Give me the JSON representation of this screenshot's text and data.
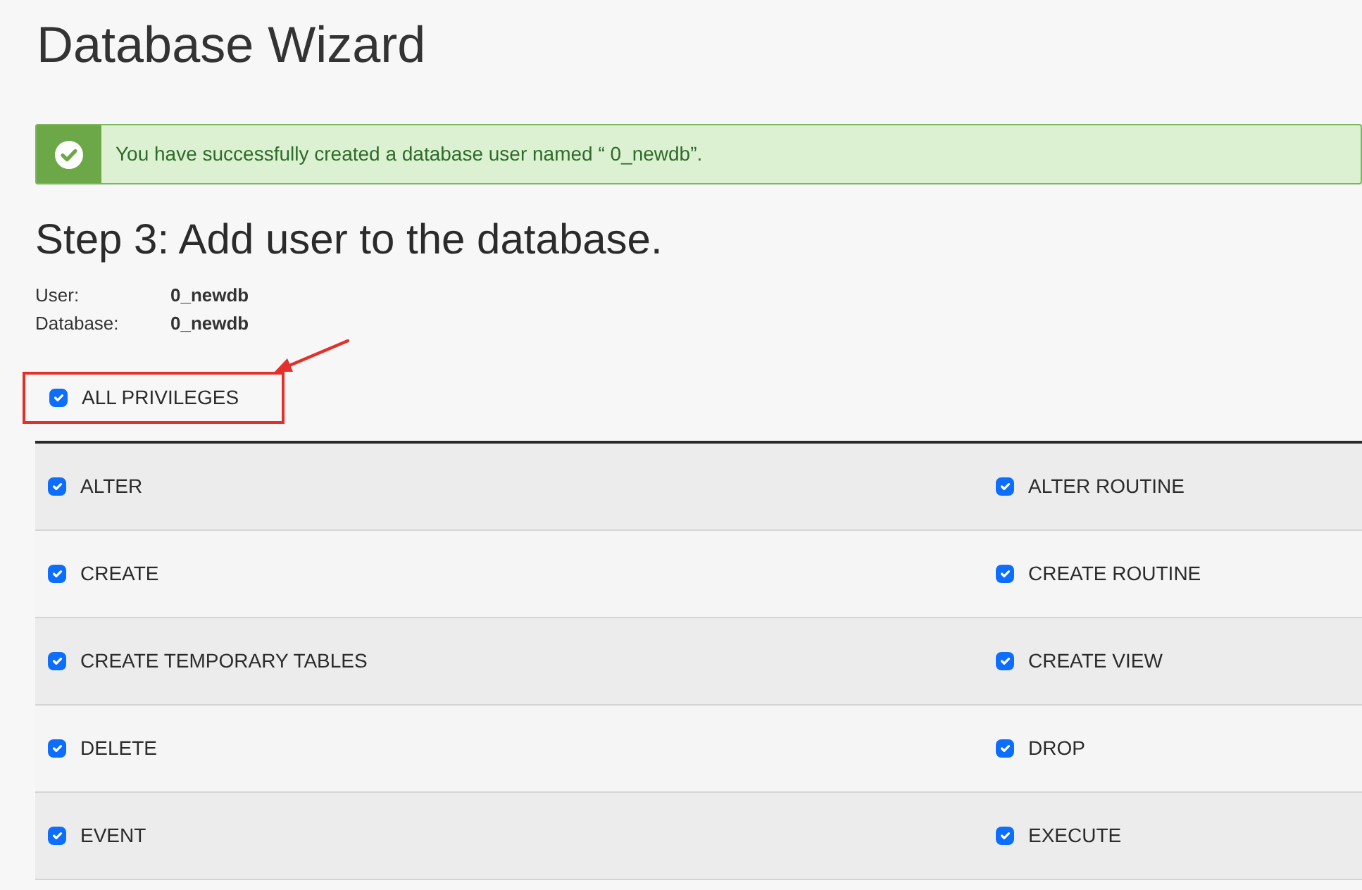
{
  "page": {
    "title": "Database Wizard"
  },
  "alert": {
    "kind": "success",
    "message": "You have successfully created a database user named “ 0_newdb”."
  },
  "step": {
    "heading": "Step 3: Add user to the database.",
    "details": [
      {
        "label": "User:",
        "value": "0_newdb"
      },
      {
        "label": "Database:",
        "value": "0_newdb"
      }
    ]
  },
  "all_privileges": {
    "label": "ALL PRIVILEGES",
    "checked": true,
    "highlighted": true
  },
  "privileges": [
    {
      "label": "ALTER",
      "checked": true
    },
    {
      "label": "ALTER ROUTINE",
      "checked": true
    },
    {
      "label": "CREATE",
      "checked": true
    },
    {
      "label": "CREATE ROUTINE",
      "checked": true
    },
    {
      "label": "CREATE TEMPORARY TABLES",
      "checked": true
    },
    {
      "label": "CREATE VIEW",
      "checked": true
    },
    {
      "label": "DELETE",
      "checked": true
    },
    {
      "label": "DROP",
      "checked": true
    },
    {
      "label": "EVENT",
      "checked": true
    },
    {
      "label": "EXECUTE",
      "checked": true
    }
  ]
}
